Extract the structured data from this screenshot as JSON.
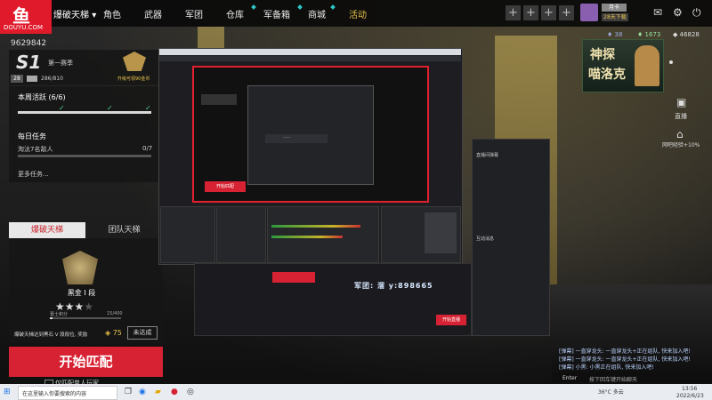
{
  "topbar": {
    "ladder": "爆破天梯",
    "nav": [
      "角色",
      "武器",
      "军团",
      "仓库",
      "军备箱",
      "商城",
      "活动"
    ],
    "right_badge": "月卡",
    "right_days": "28天下载",
    "currency_1": "38",
    "currency_2": "1673",
    "currency_3": "46828"
  },
  "logo": {
    "text": "DOUYU.COM"
  },
  "room_id": "9629842",
  "season": {
    "badge": "S1",
    "label": "第一赛季",
    "level": "28",
    "exp": "286/810",
    "upgrade": "升级可领90金币"
  },
  "weekly": {
    "title": "本周活跃 (6/6)",
    "progress": 1.0
  },
  "daily": {
    "title": "每日任务",
    "task": "淘汰7名敌人",
    "task_progress": "0/7",
    "more": "更多任务..."
  },
  "rank": {
    "tab_active": "爆破天梯",
    "tab_other": "团队天梯",
    "name": "黑金 I 段",
    "stars_filled": 3,
    "stars_total": 4,
    "points_label": "晋士积分",
    "points": "15/400",
    "note": "爆破天梯达到黑石 V 段段位, 奖励",
    "reward": "75",
    "status": "未达成"
  },
  "start_button": "开始匹配",
  "match_option": "仅匹配单人玩家",
  "ad": {
    "line1": "神探",
    "line2": "喵洛克"
  },
  "side_buttons": [
    {
      "label": "直播",
      "icon": "broadcast-icon"
    },
    {
      "label": "网吧经验+10%",
      "icon": "cafe-icon"
    }
  ],
  "obs": {
    "start_match": "开始匹配",
    "overlay_text": "军团: 溜   y:898665",
    "stop_btn": "开始直播",
    "chat_panel_title": "直播间弹幕",
    "gift_panel_title": "互动消息"
  },
  "chat": [
    "[弹幕] 一直穿龙头: 一直穿龙头+正在组队, 快来加入吧!",
    "[弹幕] 一直穿龙头: 一直穿龙头+正在组队, 快来加入吧!",
    "[弹幕] 小黑: 小黑正在组队, 快来加入吧!"
  ],
  "chat_input": {
    "label": "Enter",
    "placeholder": "按下回车键开始聊天"
  },
  "taskbar": {
    "search_placeholder": "在这里输入你要搜索的内容",
    "weather": "36°C 多云",
    "time": "13:56",
    "date": "2022/6/23"
  }
}
